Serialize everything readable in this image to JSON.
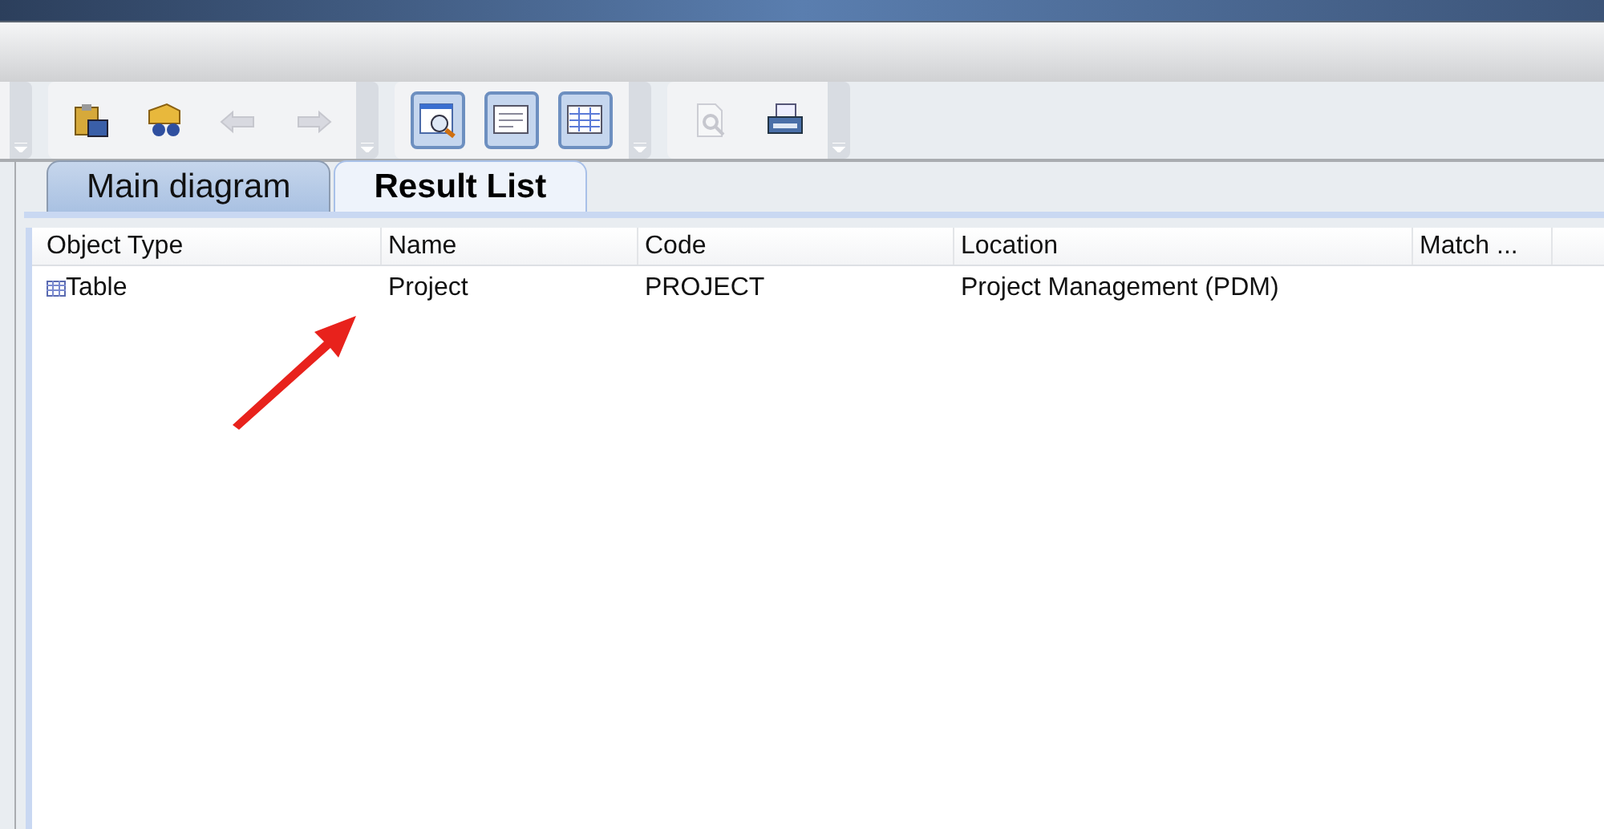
{
  "toolbar": {
    "groups": [
      {
        "buttons": [
          {
            "kind": "paste",
            "pressed": false,
            "disabled": false
          },
          {
            "kind": "find",
            "pressed": false,
            "disabled": false
          },
          {
            "kind": "back",
            "pressed": false,
            "disabled": true
          },
          {
            "kind": "forward",
            "pressed": false,
            "disabled": true
          }
        ]
      },
      {
        "buttons": [
          {
            "kind": "zoom",
            "pressed": true,
            "disabled": false
          },
          {
            "kind": "comment",
            "pressed": true,
            "disabled": false
          },
          {
            "kind": "grid",
            "pressed": true,
            "disabled": false
          }
        ]
      },
      {
        "buttons": [
          {
            "kind": "preview",
            "pressed": false,
            "disabled": true
          },
          {
            "kind": "print",
            "pressed": false,
            "disabled": false
          }
        ]
      }
    ]
  },
  "tabs": [
    {
      "label": "Main diagram",
      "selected": false
    },
    {
      "label": "Result List",
      "selected": true
    }
  ],
  "table": {
    "columns": [
      "Object Type",
      "Name",
      "Code",
      "Location",
      "Match ..."
    ],
    "rows": [
      {
        "cells": [
          "Table",
          "Project",
          "PROJECT",
          "Project Management (PDM)",
          ""
        ]
      }
    ]
  }
}
